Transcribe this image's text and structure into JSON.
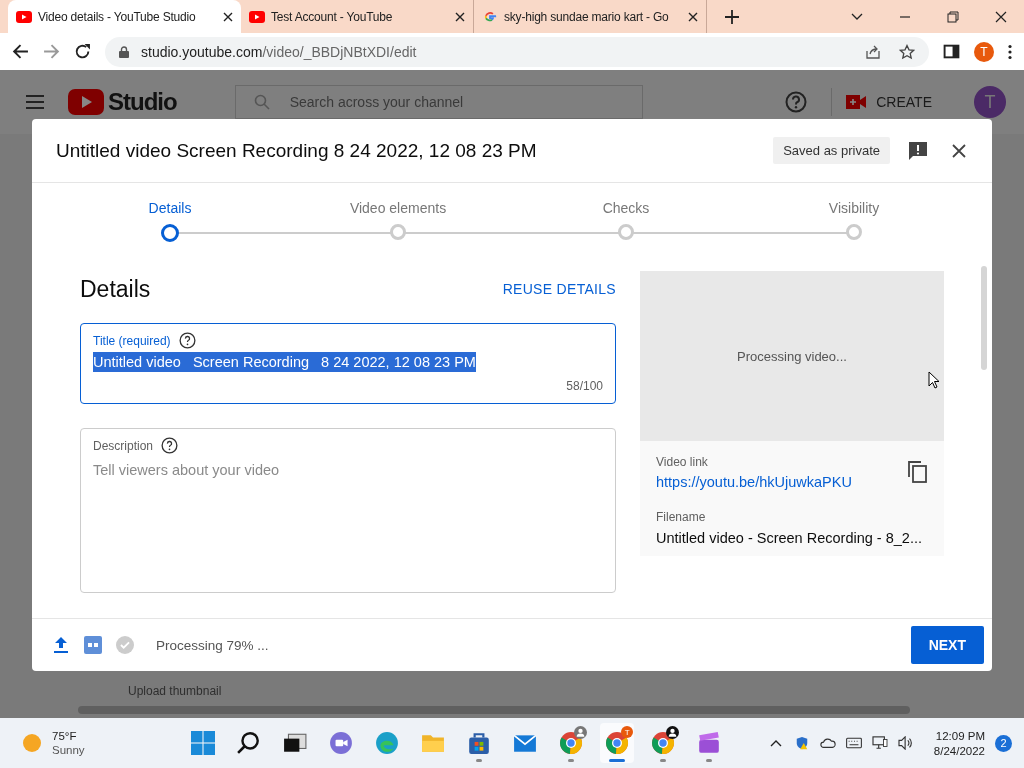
{
  "browser": {
    "tabs": [
      {
        "kind": "youtube",
        "title": "Video details - YouTube Studio",
        "selected": true
      },
      {
        "kind": "youtube",
        "title": "Test Account - YouTube",
        "selected": false
      },
      {
        "kind": "google",
        "title": "sky-high sundae mario kart - Go",
        "selected": false
      }
    ],
    "address": {
      "host": "studio.youtube.com",
      "path": "/video/_BBDjNBtXDI/edit"
    },
    "profile_initial": "T"
  },
  "studio": {
    "logo_text": "Studio",
    "search_placeholder": "Search across your channel",
    "create_label": "CREATE",
    "avatar_initial": "T",
    "upload_thumbnail": "Upload thumbnail"
  },
  "dialog": {
    "title": "Untitled video Screen Recording 8 24 2022, 12 08 23 PM",
    "saved_status": "Saved as private",
    "steps": [
      {
        "label": "Details",
        "selected": true
      },
      {
        "label": "Video elements",
        "selected": false
      },
      {
        "label": "Checks",
        "selected": false
      },
      {
        "label": "Visibility",
        "selected": false
      }
    ],
    "section_title": "Details",
    "reuse_button": "REUSE DETAILS",
    "title_field": {
      "label": "Title (required)",
      "value": "Untitled video   Screen Recording   8 24 2022, 12 08 23 PM",
      "selected_text": true,
      "counter": "58/100"
    },
    "description_field": {
      "label": "Description",
      "placeholder": "Tell viewers about your video"
    },
    "preview": {
      "status": "Processing video...",
      "link_label": "Video link",
      "link": "https://youtu.be/hkUjuwkaPKU",
      "filename_label": "Filename",
      "filename": "Untitled video - Screen Recording - 8_2..."
    },
    "footer": {
      "status": "Processing 79% ...",
      "next_button": "NEXT"
    }
  },
  "taskbar": {
    "weather": {
      "temp": "75°F",
      "condition": "Sunny"
    },
    "apps": [
      {
        "kind": "start",
        "running": false,
        "selected": false
      },
      {
        "kind": "search",
        "running": false,
        "selected": false
      },
      {
        "kind": "taskview",
        "running": false,
        "selected": false
      },
      {
        "kind": "chat",
        "running": false,
        "selected": false
      },
      {
        "kind": "edge",
        "running": false,
        "selected": false
      },
      {
        "kind": "explorer",
        "running": false,
        "selected": false
      },
      {
        "kind": "store",
        "running": true,
        "selected": false
      },
      {
        "kind": "mail",
        "running": false,
        "selected": false
      },
      {
        "kind": "chrome-person",
        "running": true,
        "selected": false
      },
      {
        "kind": "chrome-badge",
        "running": true,
        "selected": true,
        "badge": "T"
      },
      {
        "kind": "chrome-account",
        "running": true,
        "selected": false
      },
      {
        "kind": "clipchamp",
        "running": true,
        "selected": false
      }
    ],
    "time": "12:09 PM",
    "date": "8/24/2022",
    "notifications": "2"
  }
}
